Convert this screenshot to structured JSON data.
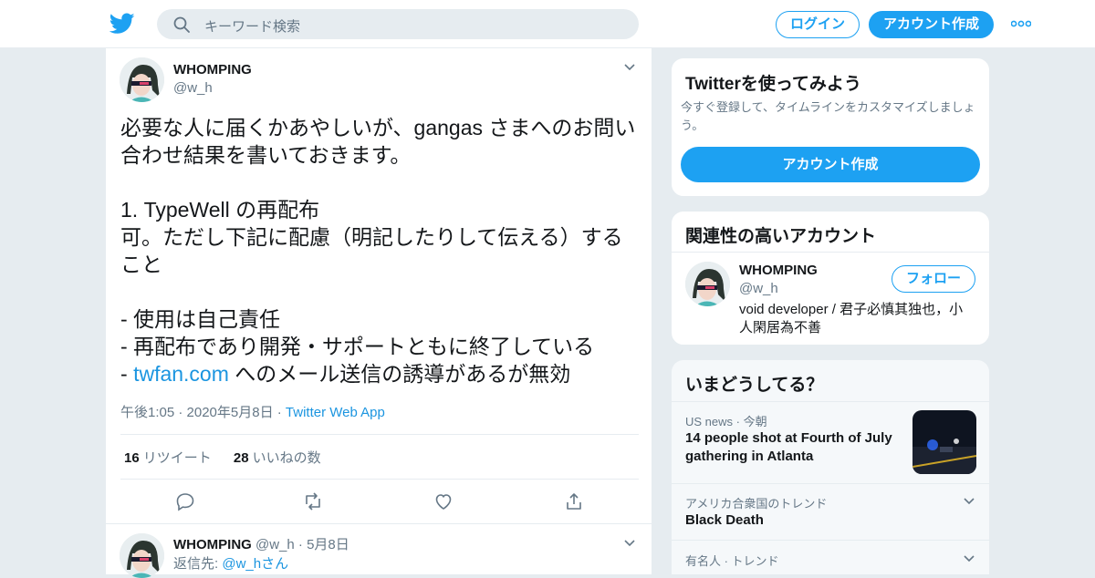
{
  "topbar": {
    "search_placeholder": "キーワード検索",
    "login_label": "ログイン",
    "signup_label": "アカウント作成"
  },
  "tweet": {
    "author_name": "WHOMPING",
    "author_handle": "@w_h",
    "text_before_link": "必要な人に届くかあやしいが、gangas さまへのお問い合わせ結果を書いておきます。\n\n1. TypeWell の再配布\n可。ただし下記に配慮（明記したりして伝える）すること\n\n- 使用は自己責任\n- 再配布であり開発・サポートともに終了している\n- ",
    "link_text": "twfan.com",
    "text_after_link": " へのメール送信の誘導があるが無効",
    "timestamp": "午後1:05 · 2020年5月8日 · ",
    "source": "Twitter Web App",
    "retweet_count": "16",
    "retweet_label": "リツイート",
    "like_count": "28",
    "like_label": "いいねの数"
  },
  "reply": {
    "author_name": "WHOMPING",
    "author_handle_date": "@w_h · 5月8日",
    "reply_to_prefix": "返信先: ",
    "reply_to_handle": "@w_hさん"
  },
  "sidebar": {
    "signup_card": {
      "title": "Twitterを使ってみよう",
      "subtitle": "今すぐ登録して、タイムラインをカスタマイズしましょう。",
      "button_label": "アカウント作成"
    },
    "related_card": {
      "title": "関連性の高いアカウント",
      "name": "WHOMPING",
      "handle": "@w_h",
      "bio": "void developer / 君子必慎其独也，小人閑居為不善",
      "follow_label": "フォロー"
    },
    "trends_card": {
      "title": "いまどうしてる？",
      "items": [
        {
          "meta": "US news · 今朝",
          "text": "14 people shot at Fourth of July gathering in Atlanta"
        },
        {
          "meta": "アメリカ合衆国のトレンド",
          "text": "Black Death"
        },
        {
          "meta": "有名人 · トレンド",
          "text": ""
        }
      ]
    }
  },
  "colors": {
    "accent": "#1da1f2",
    "link": "#1b95e0",
    "muted": "#657786",
    "background": "#e6ecf0"
  },
  "icons": [
    "twitter-logo-icon",
    "search-icon",
    "more-dots-icon",
    "chevron-down-icon",
    "reply-icon",
    "retweet-icon",
    "like-icon",
    "share-icon"
  ]
}
